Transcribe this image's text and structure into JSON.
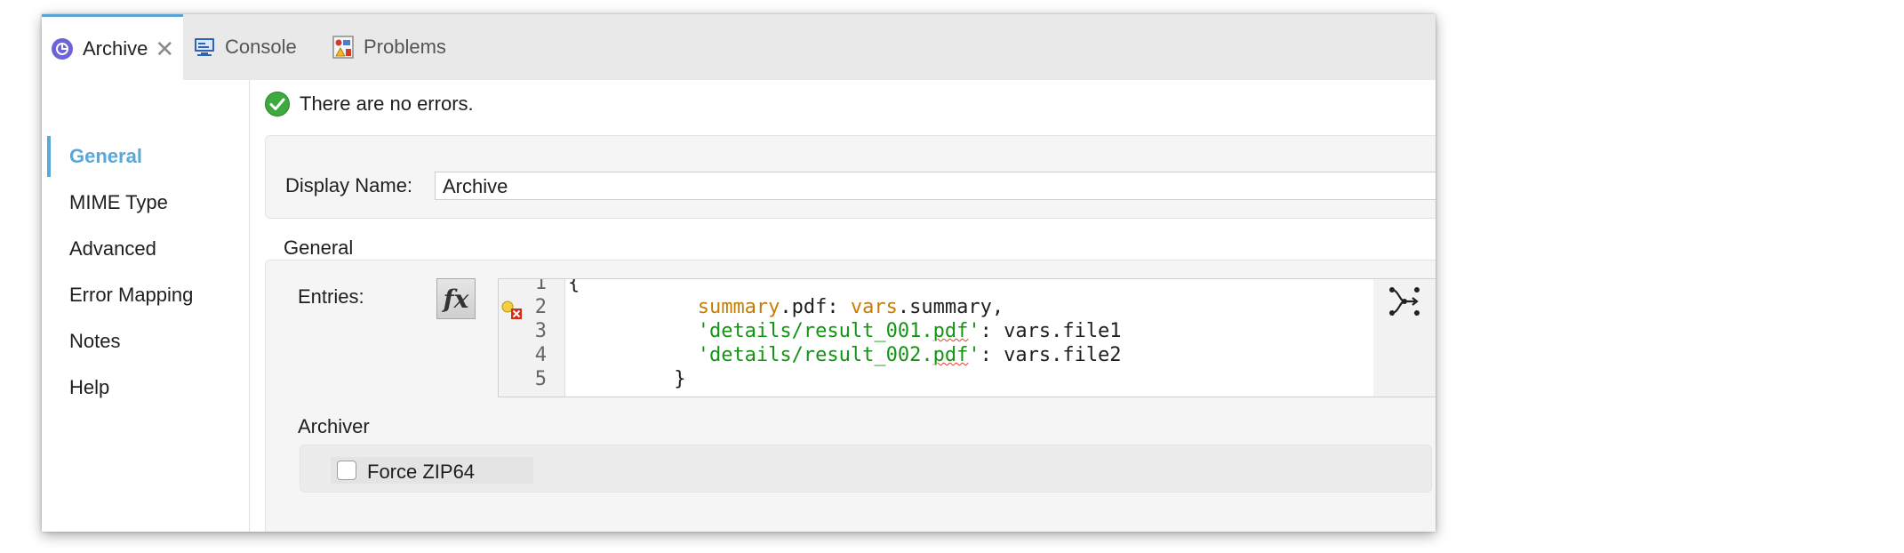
{
  "tabs": [
    {
      "label": "Archive",
      "icon": "archive-connector-icon",
      "active": true
    },
    {
      "label": "Console",
      "icon": "console-icon"
    },
    {
      "label": "Problems",
      "icon": "problems-icon"
    }
  ],
  "sidebar": {
    "items": [
      {
        "label": "General",
        "active": true
      },
      {
        "label": "MIME Type"
      },
      {
        "label": "Advanced"
      },
      {
        "label": "Error Mapping"
      },
      {
        "label": "Notes"
      },
      {
        "label": "Help"
      }
    ]
  },
  "status": {
    "text": "There are no errors.",
    "icon": "check-circle-icon"
  },
  "display_name": {
    "label": "Display Name:",
    "value": "Archive"
  },
  "general_section": {
    "title": "General"
  },
  "entries": {
    "label": "Entries:",
    "fx_label": "fx",
    "line_numbers": [
      "1",
      "2",
      "3",
      "4",
      "5"
    ],
    "lines": [
      {
        "indent": "",
        "text": "{"
      },
      {
        "indent": "           ",
        "key": "summary",
        "rest1": ".pdf: ",
        "kw2": "vars",
        "rest2": ".summary,"
      },
      {
        "indent": "           ",
        "str_a": "'details/result_001.",
        "str_b": "pdf",
        "str_c": "'",
        "rest": ": vars.file1"
      },
      {
        "indent": "           ",
        "str_a": "'details/result_002.",
        "str_b": "pdf",
        "str_c": "'",
        "rest": ": vars.file2"
      },
      {
        "indent": "         ",
        "text": "}"
      }
    ]
  },
  "archiver": {
    "title": "Archiver",
    "force_zip64_label": "Force ZIP64",
    "force_zip64_checked": false
  },
  "colors": {
    "accent": "#5aa7d9",
    "keyword": "#c57d05",
    "string": "#149414",
    "success": "#3caa3c"
  }
}
